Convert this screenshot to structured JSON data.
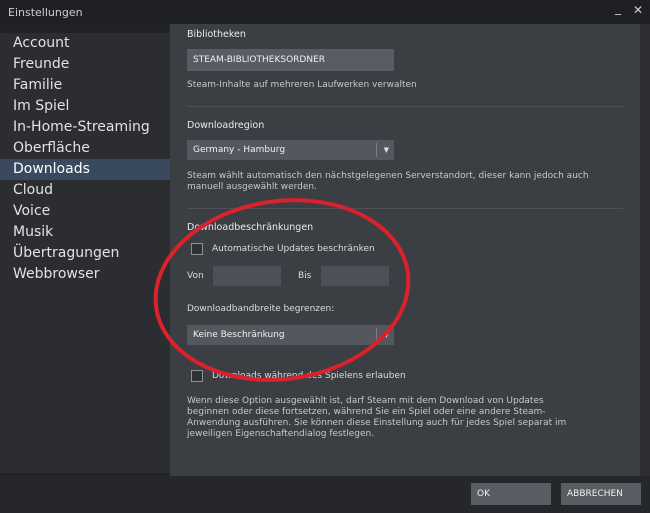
{
  "window": {
    "title": "Einstellungen",
    "minimize_glyph": "_",
    "close_glyph": "✕"
  },
  "sidebar": {
    "items": [
      {
        "label": "Account"
      },
      {
        "label": "Freunde"
      },
      {
        "label": "Familie"
      },
      {
        "label": "Im Spiel"
      },
      {
        "label": "In-Home-Streaming"
      },
      {
        "label": "Oberfläche"
      },
      {
        "label": "Downloads",
        "active": true
      },
      {
        "label": "Cloud"
      },
      {
        "label": "Voice"
      },
      {
        "label": "Musik"
      },
      {
        "label": "Übertragungen"
      },
      {
        "label": "Webbrowser"
      }
    ]
  },
  "libraries": {
    "title": "Bibliotheken",
    "button_label": "STEAM-BIBLIOTHEKSORDNER",
    "description": "Steam-Inhalte auf mehreren Laufwerken verwalten"
  },
  "region": {
    "title": "Downloadregion",
    "selected": "Germany - Hamburg",
    "description": "Steam wählt automatisch den nächstgelegenen Serverstandort, dieser kann jedoch auch manuell ausgewählt werden."
  },
  "restrictions": {
    "title": "Downloadbeschränkungen",
    "auto_updates_label": "Automatische Updates beschränken",
    "from_label": "Von",
    "to_label": "Bis",
    "bandwidth_label": "Downloadbandbreite begrenzen:",
    "bandwidth_selected": "Keine Beschränkung"
  },
  "gameplay": {
    "checkbox_label": "Downloads während des Spielens erlauben",
    "description": "Wenn diese Option ausgewählt ist, darf Steam mit dem Download von Updates beginnen oder diese fortsetzen, während Sie ein Spiel oder eine andere Steam-Anwendung ausführen. Sie können diese Einstellung auch für jedes Spiel separat im jeweiligen Eigenschaftendialog festlegen."
  },
  "footer": {
    "ok_label": "OK",
    "cancel_label": "ABBRECHEN"
  },
  "colors": {
    "annotation": "#d9222b",
    "active_nav": "#3a4a5e"
  },
  "icons": {
    "dropdown": "chevron-down-icon"
  }
}
